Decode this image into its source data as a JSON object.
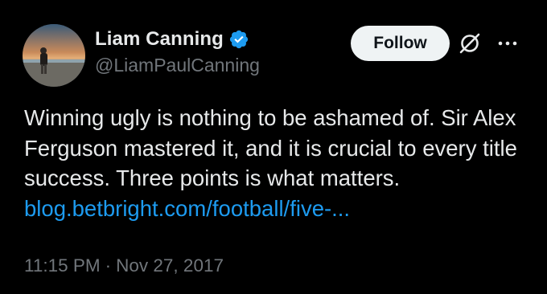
{
  "author": {
    "display_name": "Liam Canning",
    "handle": "@LiamPaulCanning",
    "verified": true
  },
  "actions": {
    "follow_label": "Follow"
  },
  "icons": {
    "verified": "verified-badge-icon",
    "grok": "grok-icon",
    "more": "more-options-icon"
  },
  "tweet": {
    "text": "Winning ugly is nothing to be ashamed of. Sir Alex Ferguson mastered it, and it is crucial to every title success. Three points is what matters.",
    "link_text": "blog.betbright.com/football/five-..."
  },
  "timestamp": {
    "time": "11:15 PM",
    "separator": "·",
    "date": "Nov 27, 2017"
  },
  "colors": {
    "background": "#000000",
    "text": "#e7e9ea",
    "secondary": "#71767b",
    "link": "#1d9bf0",
    "verified": "#1d9bf0",
    "follow_bg": "#eff3f4"
  }
}
